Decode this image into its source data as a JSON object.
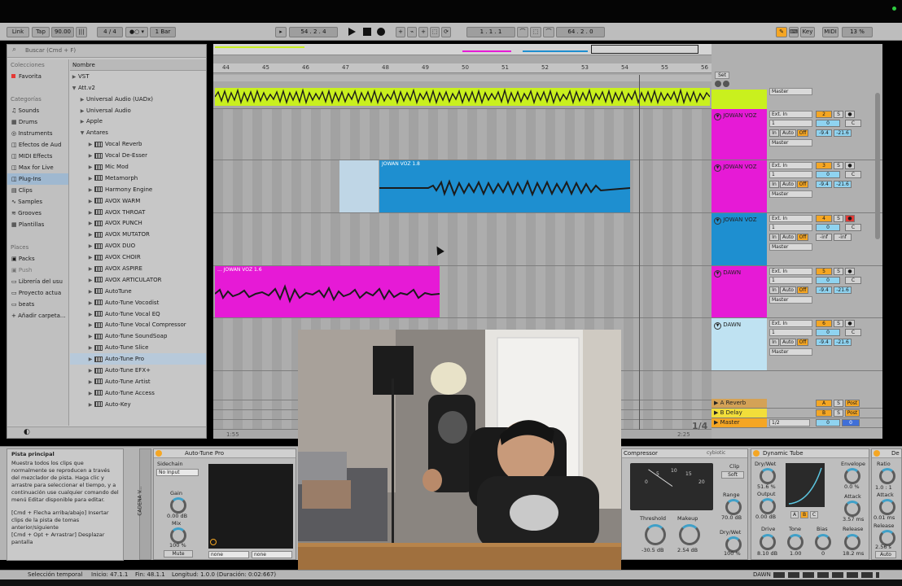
{
  "toolbar": {
    "link": "Link",
    "tap": "Tap",
    "tempo": "90.00",
    "signature": "4 / 4",
    "quant": "1 Bar",
    "position": "54 .  2 .  4",
    "loop_start": "1 .  1 .  1",
    "loop_len": "64 .  2 .  0",
    "key": "Key",
    "midi": "MIDI",
    "cpu": "13 %"
  },
  "browser": {
    "search_placeholder": "Buscar (Cmd + F)",
    "collections_header": "Colecciones",
    "favorites": "Favorita",
    "categories_header": "Categorías",
    "categories": [
      "Sounds",
      "Drums",
      "Instruments",
      "Efectos de Aud",
      "MIDI Effects",
      "Max for Live",
      "Plug-Ins",
      "Clips",
      "Samples",
      "Grooves",
      "Plantillas"
    ],
    "places_header": "Places",
    "places": [
      "Packs",
      "Push",
      "Librería del usu",
      "Proyecto actua",
      "beats",
      "Añadir carpeta..."
    ],
    "name_header": "Nombre",
    "items": [
      "VST",
      "Att.v2",
      "Universal Audio (UADx)",
      "Universal Audio",
      "Apple",
      "Antares",
      "Vocal Reverb",
      "Vocal De-Esser",
      "Mic Mod",
      "Metamorph",
      "Harmony Engine",
      "AVOX WARM",
      "AVOX THROAT",
      "AVOX PUNCH",
      "AVOX MUTATOR",
      "AVOX DUO",
      "AVOX CHOIR",
      "AVOX ASPIRE",
      "AVOX ARTICULATOR",
      "AutoTune",
      "Auto-Tune Vocodist",
      "Auto-Tune Vocal EQ",
      "Auto-Tune Vocal Compressor",
      "Auto-Tune SoundSoap",
      "Auto-Tune Slice",
      "Auto-Tune Pro",
      "Auto-Tune EFX+",
      "Auto-Tune Artist",
      "Auto-Tune Access",
      "Auto-Key"
    ]
  },
  "ruler": [
    "44",
    "45",
    "46",
    "47",
    "48",
    "49",
    "50",
    "51",
    "52",
    "53",
    "54",
    "55",
    "56"
  ],
  "set_label": "Set",
  "clips": {
    "blue": "JOWAN VOZ 1.8",
    "pink": "... JOWAN VOZ 1.6"
  },
  "tracks": [
    {
      "name": "JOWAN VOZ",
      "input": "Ext. In",
      "channel": "1",
      "out": "Master",
      "num": "2",
      "vol": "-9.4",
      "pan": "-21.6"
    },
    {
      "name": "JOWAN VOZ",
      "input": "Ext. In",
      "channel": "1",
      "out": "Master",
      "num": "3",
      "vol": "-9.4",
      "pan": "-21.6"
    },
    {
      "name": "JOWAN VOZ",
      "input": "Ext. In",
      "channel": "1",
      "out": "Master",
      "num": "4",
      "vol": "-inf",
      "pan": "-inf"
    },
    {
      "name": "DAWN",
      "input": "Ext. In",
      "channel": "1",
      "out": "Master",
      "num": "5",
      "vol": "-9.4",
      "pan": "-21.6"
    },
    {
      "name": "DAWN",
      "input": "Ext. In",
      "channel": "1",
      "out": "Master",
      "num": "6",
      "vol": "-9.4",
      "pan": "-21.6"
    }
  ],
  "returns": [
    {
      "name": "A Reverb",
      "letter": "A"
    },
    {
      "name": "B Delay",
      "letter": "B"
    },
    {
      "name": "Master",
      "letter": "0"
    }
  ],
  "misc": {
    "master_out": "Master",
    "in": "In",
    "auto": "Auto",
    "off": "Off",
    "s": "S",
    "c": "C",
    "post": "Post",
    "zero": "0",
    "one_half": "1/2",
    "time_a": "1:55",
    "time_b": "2:25",
    "fraction": "1/4"
  },
  "info_panel": {
    "title": "Pista principal",
    "body": "Muestra todos los clips que normalmente se reproducen a través del mezclador de pista. Haga clic y arrastre para seleccionar el tiempo, y a continuación use cualquier comando del menú Editar disponible para editar.",
    "hint1": "[Cmd + Flecha arriba/abajo] Insertar clips de la pista de tomas anterior/siguiente",
    "hint2": "[Cmd + Opt + Arrastrar] Desplazar pantalla"
  },
  "autotune": {
    "title": "Auto-Tune Pro",
    "chain": "CADENA V...",
    "sidechain": "Sidechain",
    "input": "No Input",
    "gain": "Gain",
    "gain_val": "0.00 dB",
    "mix": "Mix",
    "mix_val": "100 %",
    "mute": "Mute",
    "none1": "none",
    "none2": "none"
  },
  "compressor": {
    "title": "Compressor",
    "brand": "cybiotic",
    "clip": "Clip",
    "soft": "Soft",
    "range": "Range",
    "range_val": "70.0 dB",
    "threshold": "Threshold",
    "threshold_val": "-30.5 dB",
    "makeup": "Makeup",
    "makeup_val": "2.54 dB",
    "drywet": "Dry/Wet",
    "drywet_val": "100 %",
    "scale": [
      "0",
      "5",
      "10",
      "15",
      "20"
    ]
  },
  "dynamic_tube": {
    "title": "Dynamic Tube",
    "drywet": "Dry/Wet",
    "drywet_val": "51.6 %",
    "output": "Output",
    "output_val": "0.00 dB",
    "drive": "Drive",
    "drive_val": "8.10 dB",
    "tone": "Tone",
    "tone_val": "1.00",
    "bias": "Bias",
    "bias_val": "0",
    "envelope": "Envelope",
    "envelope_val": "0.0 %",
    "attack": "Attack",
    "attack_val": "3.57 ms",
    "release": "Release",
    "release_val": "18.2 ms",
    "abc": [
      "A",
      "B",
      "C"
    ]
  },
  "next_device": {
    "title": "De",
    "ratio": "Ratio",
    "ratio_val": "1.0 : 1",
    "attack": "Attack",
    "attack_val": "0.01 ms",
    "release": "Release",
    "release_val": "2.56 s",
    "auto": "Auto"
  },
  "status": {
    "mode": "Selección temporal",
    "start": "Inicio: 47.1.1",
    "end": "Fin: 48.1.1",
    "length": "Longitud: 1.0.0 (Duración: 0:02:667)",
    "dawn": "DAWN"
  },
  "colors": {
    "lime": "#c9f01e",
    "magenta": "#e61ad6",
    "blue": "#1e8fd0",
    "lightblue": "#bfe2f2",
    "orange": "#f5a623",
    "red": "#e53935"
  }
}
